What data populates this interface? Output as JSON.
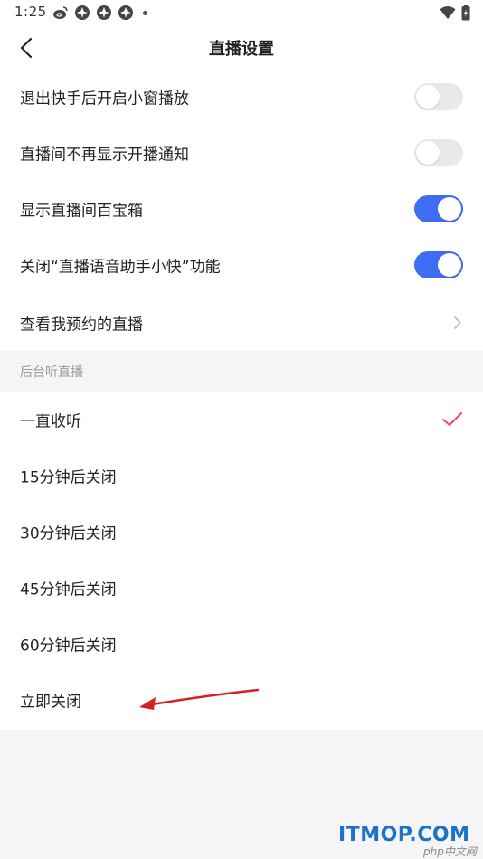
{
  "status_bar": {
    "time": "1:25",
    "icons": [
      "weibo-icon",
      "app-icon",
      "app-icon",
      "app-icon"
    ],
    "right_icons": [
      "wifi-icon",
      "battery-icon"
    ]
  },
  "header": {
    "title": "直播设置"
  },
  "settings": [
    {
      "label": "退出快手后开启小窗播放",
      "control": "toggle",
      "on": false
    },
    {
      "label": "直播间不再显示开播通知",
      "control": "toggle",
      "on": false
    },
    {
      "label": "显示直播间百宝箱",
      "control": "toggle",
      "on": true
    },
    {
      "label": "关闭“直播语音助手小快”功能",
      "control": "toggle",
      "on": true
    },
    {
      "label": "查看我预约的直播",
      "control": "chevron"
    }
  ],
  "background_listen": {
    "section_label": "后台听直播",
    "options": [
      {
        "label": "一直收听",
        "selected": true
      },
      {
        "label": "15分钟后关闭",
        "selected": false
      },
      {
        "label": "30分钟后关闭",
        "selected": false
      },
      {
        "label": "45分钟后关闭",
        "selected": false
      },
      {
        "label": "60分钟后关闭",
        "selected": false
      },
      {
        "label": "立即关闭",
        "selected": false
      }
    ]
  },
  "colors": {
    "toggle_on": "#3d6df2",
    "toggle_off": "#e9e9ec",
    "check": "#f0437a",
    "annotation_arrow": "#d42020"
  },
  "watermark": {
    "brand": "ITMOP.COM",
    "sub": "php中文网"
  }
}
